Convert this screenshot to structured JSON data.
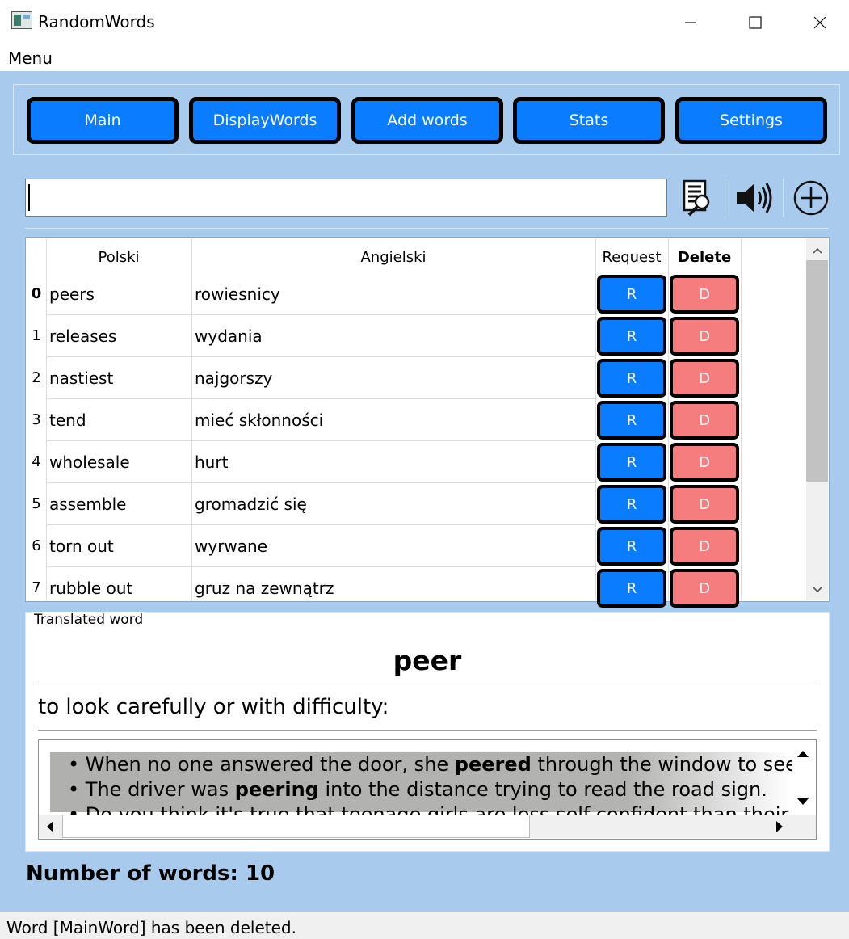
{
  "window": {
    "title": "RandomWords",
    "minimize": "—",
    "maximize": "☐",
    "close": "✕"
  },
  "menu": {
    "label": "Menu"
  },
  "nav": {
    "buttons": [
      "Main",
      "DisplayWords",
      "Add words",
      "Stats",
      "Settings"
    ]
  },
  "search": {
    "value": "",
    "placeholder": ""
  },
  "toolbar": {
    "icons": [
      "search-document-icon",
      "speaker-icon",
      "add-circle-icon"
    ]
  },
  "table": {
    "headers": {
      "polski": "Polski",
      "angielski": "Angielski",
      "request": "Request",
      "delete": "Delete"
    },
    "rows": [
      {
        "num": "0",
        "polski": "peers",
        "angielski": "rowiesnicy",
        "request": "R",
        "delete": "D"
      },
      {
        "num": "1",
        "polski": "releases",
        "angielski": "wydania",
        "request": "R",
        "delete": "D"
      },
      {
        "num": "2",
        "polski": "nastiest",
        "angielski": "najgorszy",
        "request": "R",
        "delete": "D"
      },
      {
        "num": "3",
        "polski": "tend",
        "angielski": "mieć skłonności",
        "request": "R",
        "delete": "D"
      },
      {
        "num": "4",
        "polski": "wholesale",
        "angielski": "hurt",
        "request": "R",
        "delete": "D"
      },
      {
        "num": "5",
        "polski": "assemble",
        "angielski": "gromadzić się",
        "request": "R",
        "delete": "D"
      },
      {
        "num": "6",
        "polski": "torn out",
        "angielski": "wyrwane",
        "request": "R",
        "delete": "D"
      },
      {
        "num": "7",
        "polski": "rubble out",
        "angielski": "gruz na zewnątrz",
        "request": "R",
        "delete": "D"
      }
    ]
  },
  "translated": {
    "group_title": "Translated word",
    "word": "peer",
    "definition": "to look carefully or with difficulty:",
    "examples": [
      {
        "pre": "When no one answered the door, she ",
        "bold": "peered",
        "post": " through the window to see if"
      },
      {
        "pre": "The driver was ",
        "bold": "peering",
        "post": " into the distance trying to read the road sign."
      },
      {
        "pre": "Do you think it's true that teenage girls are less self-confident than their ma",
        "bold": "",
        "post": ""
      }
    ]
  },
  "count": {
    "label": "Number of words: 10"
  },
  "status": {
    "text": "Word [MainWord] has been deleted."
  },
  "colors": {
    "accent_blue": "#0a7cff",
    "delete_red": "#f67d7d",
    "background": "#a8caec"
  }
}
